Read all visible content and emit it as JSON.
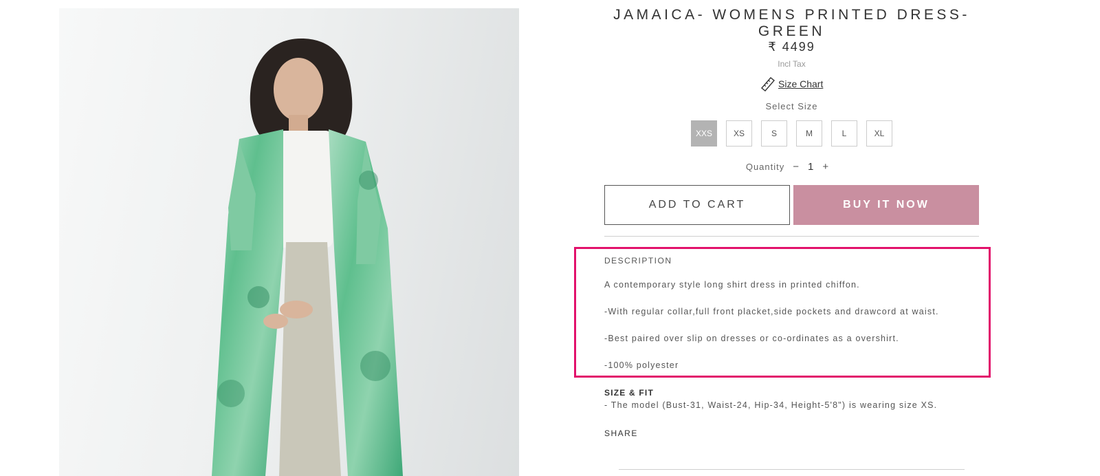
{
  "product": {
    "title": "JAMAICA- WOMENS PRINTED DRESS-GREEN",
    "price": "₹ 4499",
    "tax_note": "Incl Tax",
    "size_chart_label": "Size Chart",
    "select_size_label": "Select Size",
    "sizes": [
      "XXS",
      "XS",
      "S",
      "M",
      "L",
      "XL"
    ],
    "selected_size": "XXS",
    "quantity_label": "Quantity",
    "quantity_value": "1",
    "quantity_minus": "−",
    "quantity_plus": "+"
  },
  "actions": {
    "add_to_cart": "ADD TO CART",
    "buy_now": "BUY IT NOW"
  },
  "description": {
    "heading": "DESCRIPTION",
    "lines": [
      "A contemporary style long shirt dress in printed chiffon.",
      "-With regular collar,full front placket,side pockets and drawcord at waist.",
      "-Best paired over slip on dresses or co-ordinates as a overshirt.",
      "-100% polyester"
    ]
  },
  "size_fit": {
    "heading": "SIZE & FIT",
    "text": "- The model (Bust-31, Waist-24, Hip-34, Height-5'8\") is wearing size XS."
  },
  "share_label": "SHARE",
  "colors": {
    "buy_button": "#c98fa0",
    "highlight_box": "#e2116b",
    "selected_size": "#b3b3b3",
    "dress_green": "#4fb886"
  },
  "icons": [
    "ruler-icon"
  ]
}
